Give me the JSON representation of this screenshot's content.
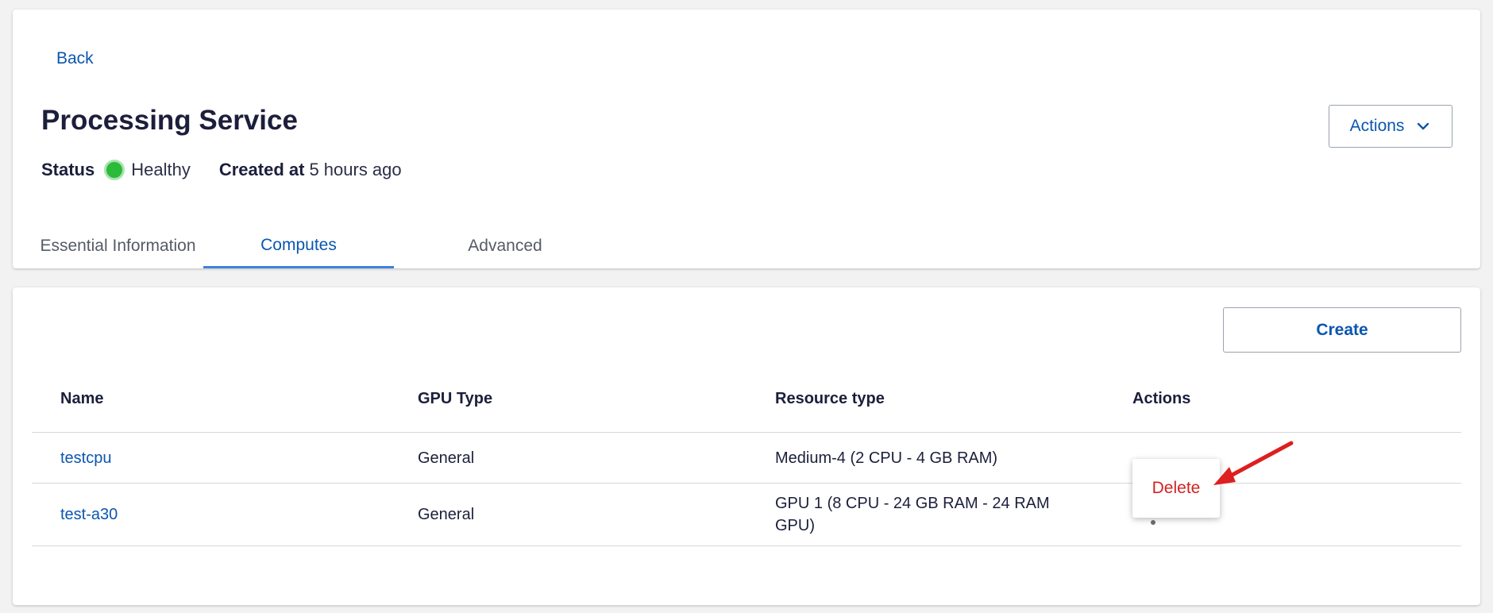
{
  "header": {
    "back_label": "Back",
    "title": "Processing Service",
    "status_label": "Status",
    "status_value": "Healthy",
    "created_label": "Created at",
    "created_value": "5 hours ago",
    "actions_label": "Actions"
  },
  "tabs": [
    {
      "label": "Essential Information",
      "active": false
    },
    {
      "label": "Computes",
      "active": true
    },
    {
      "label": "Advanced",
      "active": false
    }
  ],
  "computes": {
    "create_label": "Create",
    "columns": [
      "Name",
      "GPU Type",
      "Resource type",
      "Actions"
    ],
    "rows": [
      {
        "name": "testcpu",
        "gpu_type": "General",
        "resource_type": "Medium-4 (2 CPU - 4 GB RAM)"
      },
      {
        "name": "test-a30",
        "gpu_type": "General",
        "resource_type": "GPU 1 (8 CPU - 24 GB RAM - 24 RAM GPU)"
      }
    ],
    "menu": {
      "delete_label": "Delete"
    }
  },
  "colors": {
    "accent": "#0b56b0",
    "status_healthy": "#2bba39",
    "danger": "#d32222"
  },
  "icons": {
    "actions_chevron": "chevron-down-icon",
    "row_menu": "kebab-menu-icon",
    "annotation": "red-arrow-icon"
  }
}
